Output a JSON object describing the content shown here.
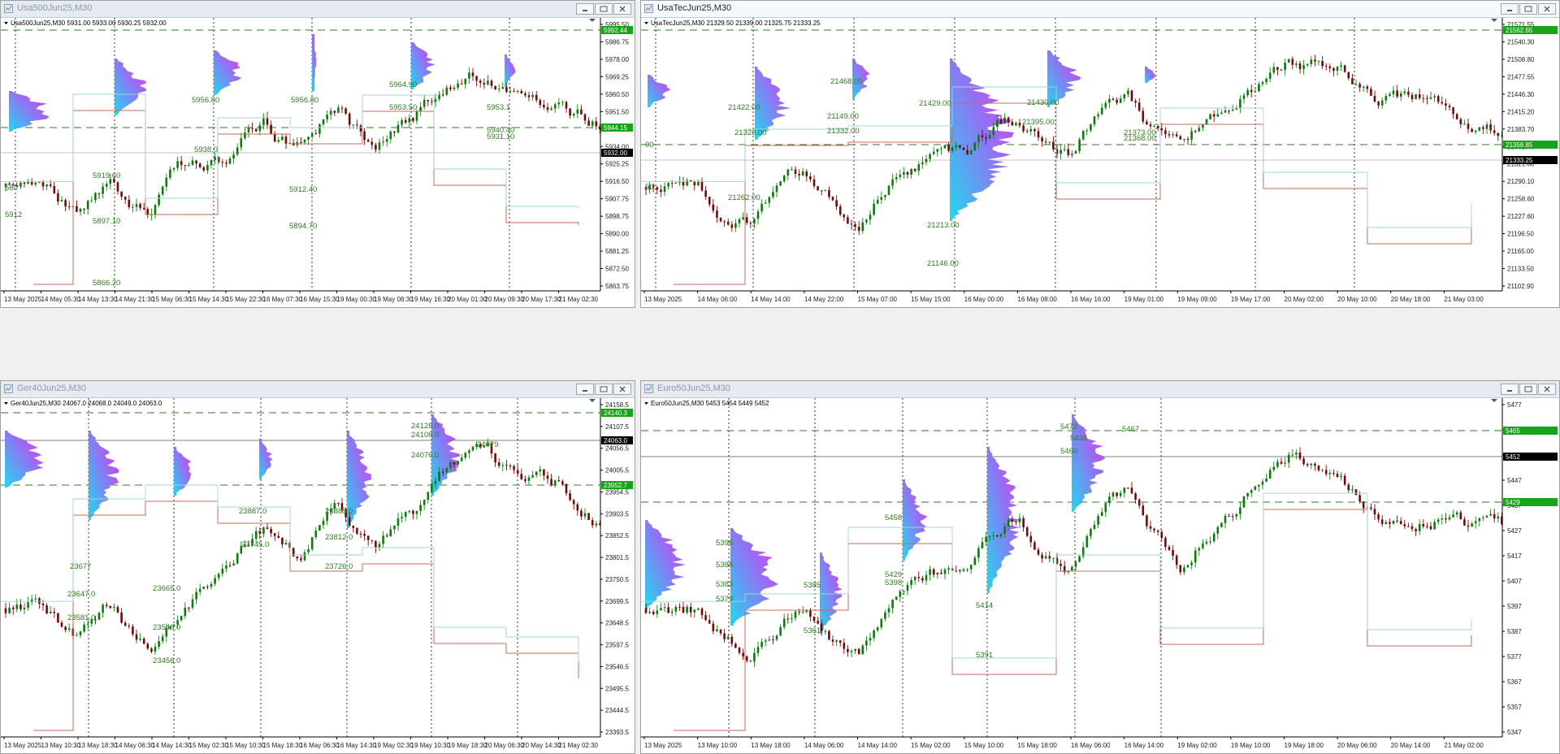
{
  "windows": [
    {
      "title": "Usa500Jun25,M30",
      "active": false,
      "header": "Usa500Jun25,M30  5931.00 5933.00 5930.25 5932.00",
      "yticks": [
        "5995.50",
        "5986.75",
        "5978.00",
        "5969.25",
        "5960.50",
        "5951.50",
        "5942.75",
        "5934.00",
        "5925.25",
        "5916.50",
        "5907.75",
        "5898.75",
        "5890.00",
        "5881.25",
        "5872.50",
        "5863.75"
      ],
      "xticks": [
        "13 May 2025",
        "14 May 05:30",
        "14 May 13:30",
        "14 May 21:30",
        "15 May 06:30",
        "15 May 14:30",
        "15 May 22:30",
        "16 May 07:30",
        "16 May 15:30",
        "19 May 00:30",
        "19 May 08:30",
        "19 May 16:30",
        "20 May 01:30",
        "20 May 09:30",
        "20 May 17:30",
        "21 May 02:30"
      ],
      "tags": [
        {
          "text": "5992.44",
          "kind": "green"
        },
        {
          "text": "5944.15",
          "kind": "green"
        },
        {
          "text": "5932.00",
          "kind": "black"
        }
      ],
      "labels": [
        "5956.80",
        "5938.0",
        "5919.60",
        "5897.10",
        "5866.20",
        "5956.80",
        "5912.40",
        "5894.70",
        "5964.90",
        "5953.50",
        "5953.1",
        "5940.40",
        "5931.10",
        "580",
        "5912"
      ]
    },
    {
      "title": "UsaTecJun25,M30",
      "active": true,
      "header": "UsaTecJun25,M30  21329.50 21339.00 21325.75 21333.25",
      "yticks": [
        "21571.55",
        "21540.30",
        "21508.80",
        "21477.55",
        "21446.30",
        "21415.20",
        "21383.70",
        "21352.45",
        "21321.60",
        "21290.10",
        "21258.60",
        "21227.60",
        "21196.50",
        "21165.00",
        "21133.50",
        "21102.90"
      ],
      "xticks": [
        "13 May 2025",
        "14 May 06:00",
        "14 May 14:00",
        "14 May 22:00",
        "15 May 07:00",
        "15 May 15:00",
        "16 May 00:00",
        "16 May 08:00",
        "16 May 16:00",
        "19 May 01:00",
        "19 May 09:00",
        "19 May 17:00",
        "20 May 02:00",
        "20 May 10:00",
        "20 May 18:00",
        "21 May 03:00"
      ],
      "tags": [
        {
          "text": "21562.65",
          "kind": "green"
        },
        {
          "text": "21358.85",
          "kind": "green"
        },
        {
          "text": "21333.25",
          "kind": "black"
        }
      ],
      "labels": [
        "21422.00",
        "21328.00",
        "21262.00",
        "21468.00",
        "21332.00",
        "21429.00",
        "21430.00",
        "21395.00",
        "21373.00",
        "21368.00",
        "21213.00",
        "21146.00",
        "21149.00",
        "00",
        "50"
      ]
    },
    {
      "title": "Ger40Jun25,M30",
      "active": false,
      "header": "Ger40Jun25,M30  24067.0 24068.0 24049.0 24063.0",
      "yticks": [
        "24158.5",
        "24107.5",
        "24056.5",
        "24005.5",
        "23954.5",
        "23903.5",
        "23852.5",
        "23801.5",
        "23750.5",
        "23699.5",
        "23648.5",
        "23597.5",
        "23546.5",
        "23495.5",
        "23444.5",
        "23393.5"
      ],
      "xticks": [
        "13 May 2025",
        "13 May 10:30",
        "13 May 18:30",
        "14 May 06:30",
        "14 May 14:30",
        "15 May 02:30",
        "15 May 10:30",
        "15 May 18:30",
        "16 May 06:30",
        "16 May 14:30",
        "19 May 02:30",
        "19 May 10:30",
        "19 May 18:30",
        "20 May 06:30",
        "20 May 14:30",
        "21 May 02:30"
      ],
      "tags": [
        {
          "text": "24140.3",
          "kind": "green"
        },
        {
          "text": "24063.0",
          "kind": "black"
        },
        {
          "text": "23952.7",
          "kind": "green"
        }
      ],
      "labels": [
        "24128.0",
        "24108.0",
        "24076.0",
        "23887.0",
        "23885.0",
        "23812.0",
        "23745.0",
        "23726.0",
        "23665.0",
        "23647.0",
        "23581.0",
        "23456.0",
        "23546.0",
        "23677",
        "24079"
      ]
    },
    {
      "title": "Euro50Jun25,M30",
      "active": false,
      "header": "Euro50Jun25,M30  5453 5454 5449 5452",
      "yticks": [
        "5477",
        "5467",
        "5457",
        "5447",
        "5437",
        "5427",
        "5417",
        "5407",
        "5397",
        "5387",
        "5377",
        "5367",
        "5357",
        "5347"
      ],
      "xticks": [
        "13 May 2025",
        "13 May 10:00",
        "13 May 18:00",
        "14 May 06:00",
        "14 May 14:00",
        "15 May 02:00",
        "15 May 10:00",
        "15 May 18:00",
        "16 May 06:00",
        "16 May 14:00",
        "19 May 02:00",
        "19 May 10:00",
        "19 May 18:00",
        "20 May 06:00",
        "20 May 14:00",
        "21 May 02:00"
      ],
      "tags": [
        {
          "text": "5465",
          "kind": "green"
        },
        {
          "text": "5452",
          "kind": "black"
        },
        {
          "text": "5429",
          "kind": "green"
        }
      ],
      "labels": [
        "5472",
        "5460",
        "5458",
        "5429",
        "5414",
        "5391",
        "5398",
        "5388",
        "5379",
        "5383",
        "5361",
        "5396",
        "5438",
        "5385",
        "5467"
      ]
    }
  ],
  "icons": {
    "window_icon": "chart-window-icon",
    "minimize": "minimize-icon",
    "maximize": "restore-icon",
    "close": "close-icon"
  }
}
